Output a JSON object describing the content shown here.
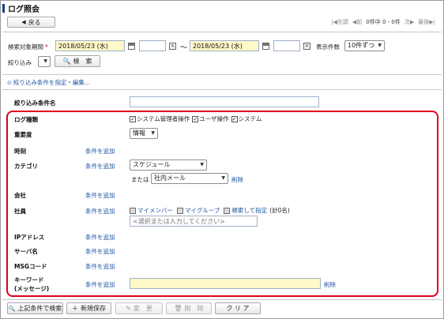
{
  "page": {
    "title": "ログ照会"
  },
  "nav": {
    "back_label": "戻る",
    "back_arrow": "◀",
    "first": "先頭",
    "prev": "前",
    "count": "0件中 0 - 0件",
    "next": "次",
    "last": "最後"
  },
  "search": {
    "period_label": "検索対象期間",
    "required_mark": "*",
    "date_from": "2018/05/23 (水)",
    "time_from": "",
    "tilde": "～",
    "date_to": "2018/05/23 (水)",
    "time_to": "",
    "display_count_label": "表示件数",
    "display_count_value": "10件ずつ",
    "filter_label": "絞り込み",
    "filter_value": "",
    "search_button": "検　索"
  },
  "toggle": {
    "label": "絞り込み条件を指定・編集…"
  },
  "form": {
    "condition_name_label": "絞り込み条件名",
    "condition_name_value": "",
    "log_type_label": "ログ種類",
    "log_types": [
      "システム管理者操作",
      "ユーザ操作",
      "システム"
    ],
    "severity_label": "重要度",
    "severity_value": "情報",
    "time_label": "時刻",
    "category_label": "カテゴリ",
    "category_value": "スケジュール",
    "or_label": "または",
    "category_value2": "社内メール",
    "delete_label": "削除",
    "company_label": "会社",
    "employee_label": "社員",
    "my_member": "マイメンバー",
    "my_group": "マイグループ",
    "search_specify": "検索して指定",
    "total": "(計0名)",
    "employee_placeholder": "<選択または入力してください>",
    "ip_label": "IPアドレス",
    "server_label": "サーバ名",
    "msg_label": "MSGコード",
    "keyword_label_1": "キーワード",
    "keyword_label_2": "(メッセージ)",
    "keyword_value": "",
    "add_condition": "条件を追加"
  },
  "footer": {
    "search_with_conditions": "上記条件で検索",
    "new_save": "新規保存",
    "change": "変　更",
    "delete": "削　除",
    "clear": "ク リ ア"
  }
}
